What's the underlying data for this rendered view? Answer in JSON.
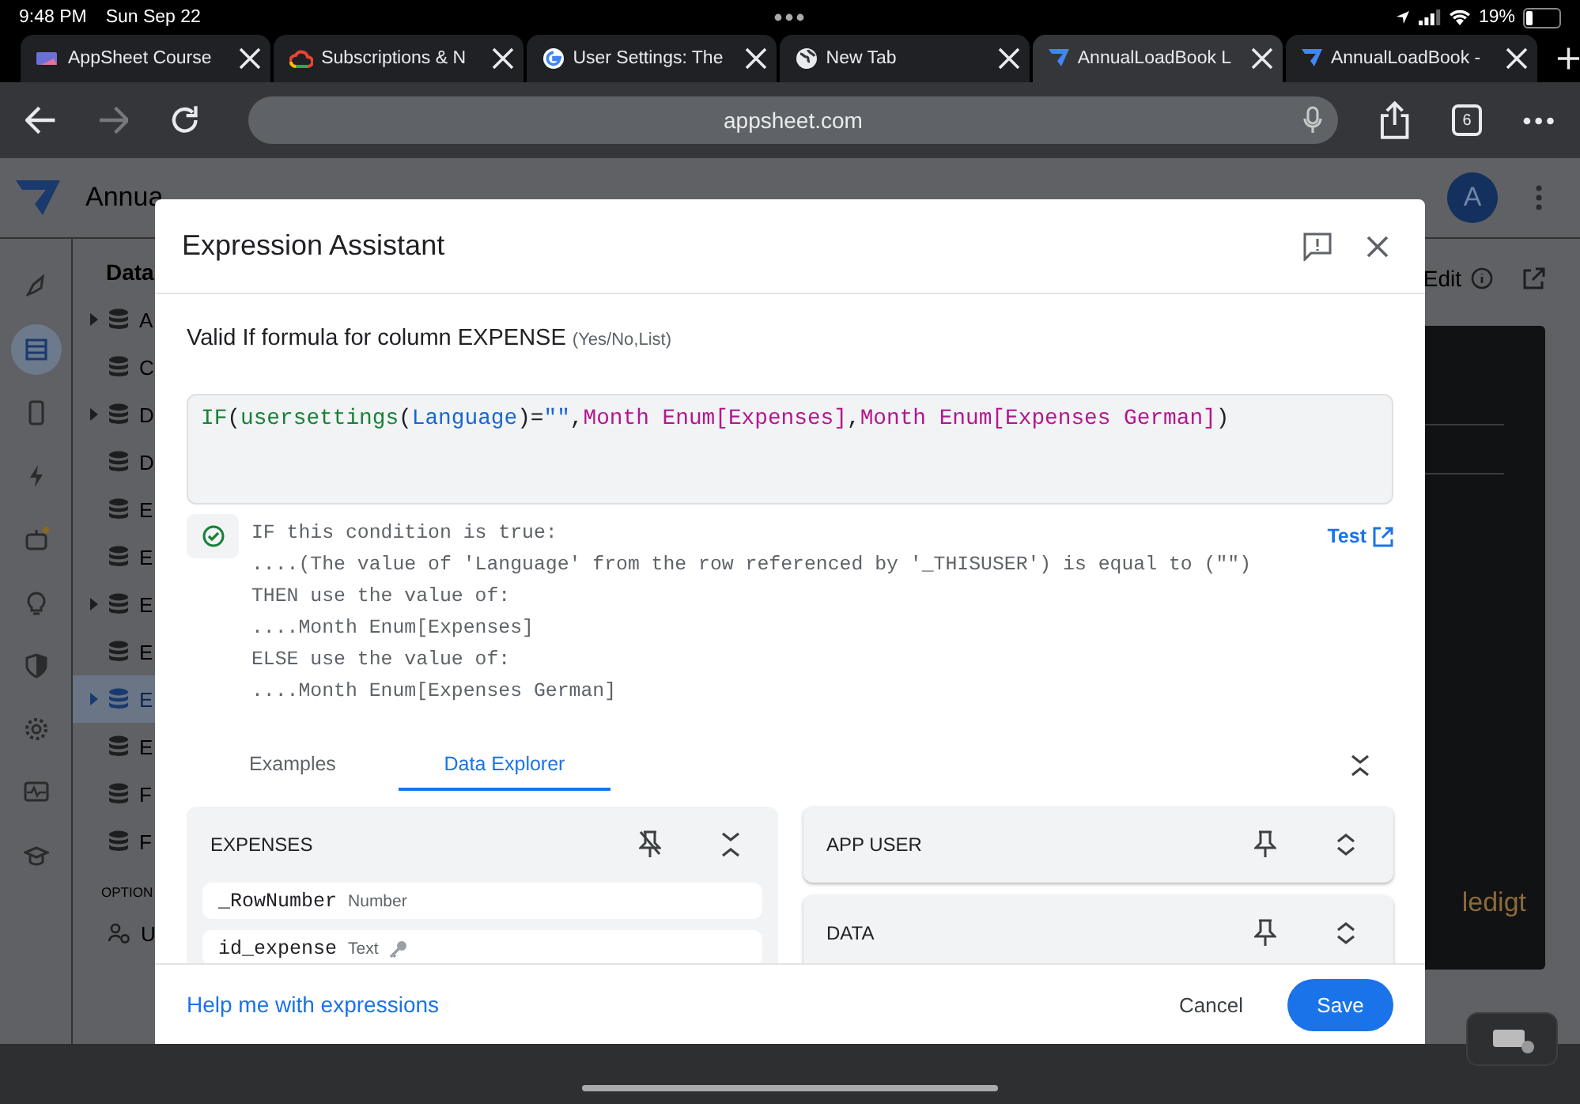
{
  "status_bar": {
    "time": "9:48 PM",
    "date": "Sun Sep 22",
    "battery": "19%"
  },
  "browser_tabs": [
    {
      "title": "AppSheet Course",
      "selected": false
    },
    {
      "title": "Subscriptions & N",
      "selected": false
    },
    {
      "title": "User Settings: The",
      "selected": false
    },
    {
      "title": "New Tab",
      "selected": false
    },
    {
      "title": "AnnualLoadBook L",
      "selected": true
    },
    {
      "title": "AnnualLoadBook -",
      "selected": false
    }
  ],
  "toolbar": {
    "url": "appsheet.com",
    "tab_count": "6",
    "forward_disabled": true
  },
  "app": {
    "title": "Annua",
    "avatar": "A",
    "edit_label": "Edit",
    "preview_text": "ledigt",
    "rail": [
      {
        "selected": false
      },
      {
        "selected": true
      },
      {
        "selected": false
      },
      {
        "selected": false
      },
      {
        "selected": false
      },
      {
        "selected": false
      },
      {
        "selected": false
      },
      {
        "selected": false
      },
      {
        "selected": false
      },
      {
        "selected": false
      }
    ],
    "sidebar_heading": "Data",
    "tables": [
      {
        "label": "A",
        "expandable": true,
        "selected": false
      },
      {
        "label": "C",
        "expandable": false,
        "selected": false
      },
      {
        "label": "D",
        "expandable": true,
        "selected": false
      },
      {
        "label": "D",
        "expandable": false,
        "selected": false
      },
      {
        "label": "E",
        "expandable": false,
        "selected": false
      },
      {
        "label": "E",
        "expandable": false,
        "selected": false
      },
      {
        "label": "E",
        "expandable": true,
        "selected": false
      },
      {
        "label": "E",
        "expandable": false,
        "selected": false
      },
      {
        "label": "E",
        "expandable": true,
        "selected": true
      },
      {
        "label": "E",
        "expandable": false,
        "selected": false
      },
      {
        "label": "F",
        "expandable": false,
        "selected": false
      },
      {
        "label": "F",
        "expandable": false,
        "selected": false
      }
    ],
    "options_heading": "OPTION",
    "options_item": "U"
  },
  "dialog": {
    "title": "Expression Assistant",
    "subtitle": "Valid If formula for column EXPENSE",
    "subtitle_hint": "(Yes/No,List)",
    "code": [
      {
        "text": "IF",
        "kind": "function"
      },
      {
        "text": "(",
        "kind": "punct"
      },
      {
        "text": "usersettings",
        "kind": "function"
      },
      {
        "text": "(",
        "kind": "punct"
      },
      {
        "text": "Language",
        "kind": "field"
      },
      {
        "text": ")=",
        "kind": "punct"
      },
      {
        "text": "\"\"",
        "kind": "string"
      },
      {
        "text": ",",
        "kind": "punct"
      },
      {
        "text": "Month Enum[Expenses]",
        "kind": "column"
      },
      {
        "text": ",",
        "kind": "punct"
      },
      {
        "text": "Month Enum[Expenses German]",
        "kind": "column"
      },
      {
        "text": ")",
        "kind": "punct"
      }
    ],
    "valid": true,
    "explanation": [
      "IF this condition is true:",
      "....(The value of 'Language' from the row referenced by '_THISUSER') is equal to (\"\")",
      "THEN use the value of:",
      "....Month Enum[Expenses]",
      "ELSE use the value of:",
      "....Month Enum[Expenses German]"
    ],
    "test_link": "Test",
    "tabs": [
      {
        "label": "Examples",
        "selected": false
      },
      {
        "label": "Data Explorer",
        "selected": true
      }
    ],
    "left_panels": [
      {
        "title": "EXPENSES",
        "pinned": true,
        "expanded": true,
        "columns": [
          {
            "name": "_RowNumber",
            "type": "Number",
            "key": false
          },
          {
            "name": "id_expense",
            "type": "Text",
            "key": true
          }
        ]
      }
    ],
    "right_panels": [
      {
        "title": "APP USER",
        "pinned": false,
        "expanded": false
      },
      {
        "title": "DATA",
        "pinned": false,
        "expanded": false
      }
    ],
    "help_link": "Help me with expressions",
    "cancel": "Cancel",
    "save": "Save"
  }
}
